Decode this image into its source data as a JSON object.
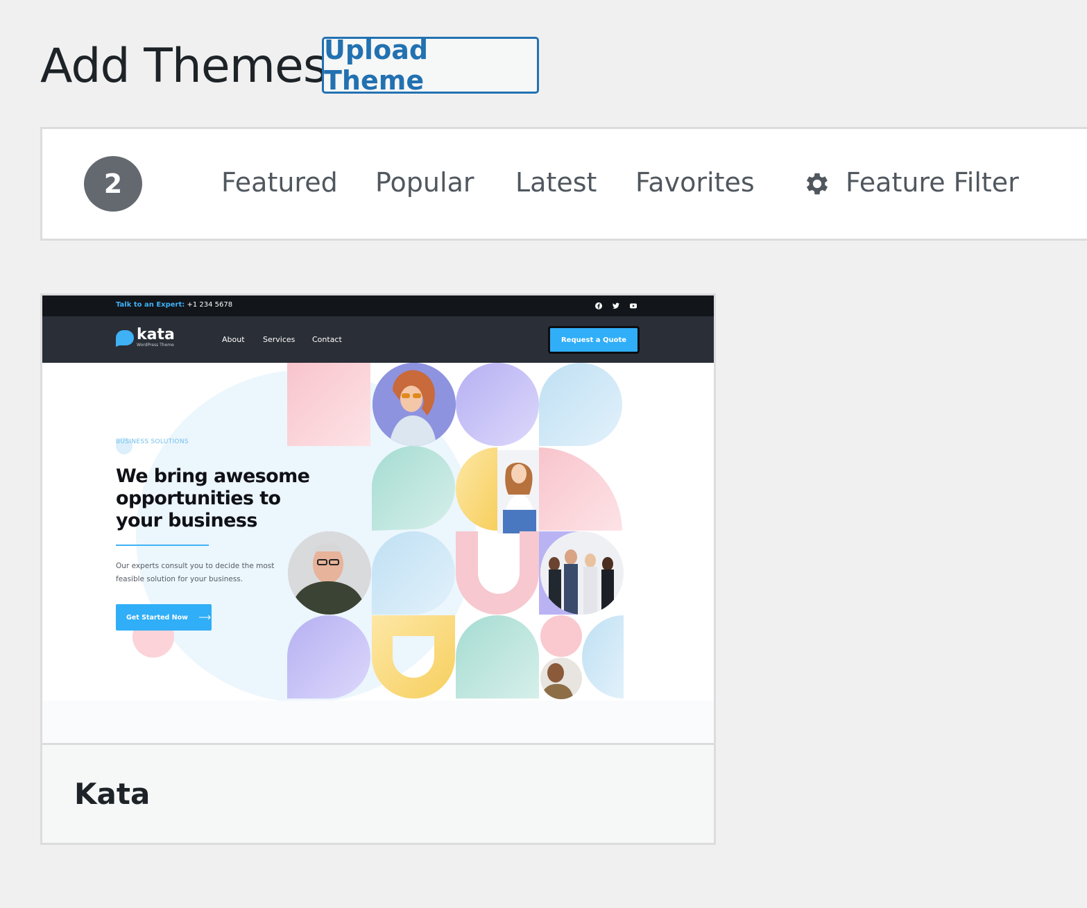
{
  "header": {
    "title": "Add Themes",
    "upload_label": "Upload Theme"
  },
  "filter_bar": {
    "count": "2",
    "tabs": [
      "Featured",
      "Popular",
      "Latest",
      "Favorites"
    ],
    "feature_filter_label": "Feature Filter"
  },
  "theme": {
    "name": "Kata",
    "preview": {
      "talk_label": "Talk to an Expert:",
      "phone": "+1 234 5678",
      "logo_text": "kata",
      "logo_sub": "WordPress Theme",
      "nav": [
        "About",
        "Services",
        "Contact"
      ],
      "quote_button": "Request a Quote",
      "badge": "BUSINESS SOLUTIONS",
      "headline": "We bring awesome opportunities to your business",
      "description": "Our experts consult you to decide the most feasible solution for your business.",
      "cta": "Get Started Now",
      "social_icons": [
        "facebook-icon",
        "twitter-icon",
        "youtube-icon"
      ]
    }
  },
  "colors": {
    "accent": "#2271b1",
    "badge_bg": "#646970",
    "preview_accent": "#30aef7"
  }
}
